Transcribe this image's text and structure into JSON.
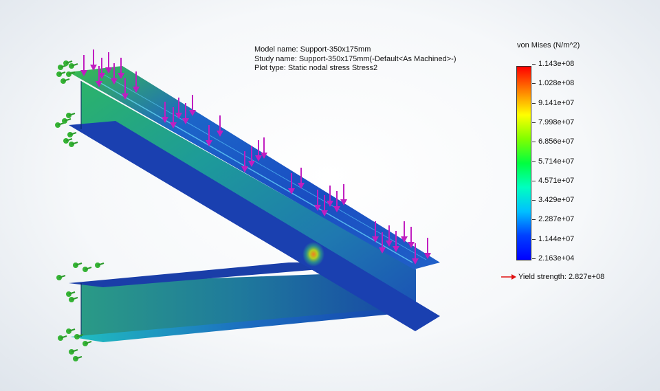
{
  "info": {
    "model_name": "Model name: Support-350x175mm",
    "study_name": "Study name: Support-350x175mm(-Default<As Machined>-)",
    "plot_type": "Plot type: Static nodal stress Stress2"
  },
  "legend": {
    "title": "von Mises (N/m^2)",
    "ticks": [
      "1.143e+08",
      "1.028e+08",
      "9.141e+07",
      "7.998e+07",
      "6.856e+07",
      "5.714e+07",
      "4.571e+07",
      "3.429e+07",
      "2.287e+07",
      "1.144e+07",
      "2.163e+04"
    ],
    "yield_label": "Yield strength: 2.827e+08",
    "colors": [
      "#ff0000",
      "#ff8000",
      "#ffff00",
      "#80ff00",
      "#00ff40",
      "#00ffc0",
      "#00c0ff",
      "#0040ff",
      "#0000ff"
    ]
  },
  "colors": {
    "load_arrow": "#c01ec0",
    "fixture": "#35b335",
    "beam_dark": "#0c2a8a",
    "beam_mid": "#2a7ab5",
    "beam_green": "#34c080"
  }
}
